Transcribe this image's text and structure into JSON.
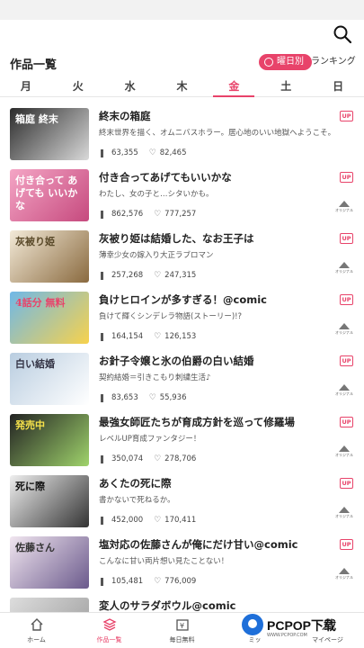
{
  "header": {
    "title": "作品一覧",
    "toggle_day": "曜日別",
    "toggle_rank": "ランキング"
  },
  "days": [
    "月",
    "火",
    "水",
    "木",
    "金",
    "土",
    "日"
  ],
  "active_day": "金",
  "items": [
    {
      "title": "終末の箱庭",
      "sub": "終末世界を描く、オムニバスホラー。居心地のいい地獄へようこそ。",
      "views": "63,355",
      "likes": "82,465",
      "up": "UP",
      "original": "",
      "thumb_text": "箱庭 終末"
    },
    {
      "title": "付き合ってあげてもいいかな",
      "sub": "わたし、女の子と…シタいかも。",
      "views": "862,576",
      "likes": "777,257",
      "up": "UP",
      "original": "オリジナル",
      "thumb_text": "付き合って あげても いいかな"
    },
    {
      "title": "灰被り姫は結婚した、なお王子は",
      "sub": "薄幸少女の嫁入り大正ラブロマン",
      "views": "257,268",
      "likes": "247,315",
      "up": "UP",
      "original": "オリジナル",
      "thumb_text": "灰被り姫"
    },
    {
      "title": "負けヒロインが多すぎる！@comic",
      "sub": "負けて輝くシンデレラ物語(ストーリー)!?",
      "views": "164,154",
      "likes": "126,153",
      "up": "UP",
      "original": "オリジナル",
      "thumb_text": "4話分 無料"
    },
    {
      "title": "お針子令嬢と氷の伯爵の白い結婚",
      "sub": "契約結婚＝引きこもり刺繍生活♪",
      "views": "83,653",
      "likes": "55,936",
      "up": "UP",
      "original": "オリジナル",
      "thumb_text": "白い結婚"
    },
    {
      "title": "最強女師匠たちが育成方針を巡って修羅場",
      "sub": "レベルUP育成ファンタジー！",
      "views": "350,074",
      "likes": "278,706",
      "up": "UP",
      "original": "オリジナル",
      "thumb_text": "発売中"
    },
    {
      "title": "あくたの死に際",
      "sub": "書かないで死ねるか。",
      "views": "452,000",
      "likes": "170,411",
      "up": "UP",
      "original": "オリジナル",
      "thumb_text": "死に際"
    },
    {
      "title": "塩対応の佐藤さんが俺にだけ甘い@comic",
      "sub": "こんなに甘い両片想い見たことない！",
      "views": "105,481",
      "likes": "776,009",
      "up": "UP",
      "original": "オリジナル",
      "thumb_text": "佐藤さん"
    },
    {
      "title": "変人のサラダボウル@comic",
      "sub": "",
      "views": "",
      "likes": "",
      "up": "",
      "original": "",
      "thumb_text": ""
    }
  ],
  "tabbar": [
    {
      "label": "ホーム",
      "icon": "home-icon"
    },
    {
      "label": "作品一覧",
      "icon": "books-icon"
    },
    {
      "label": "毎日無料",
      "icon": "yen-icon"
    },
    {
      "label": "ミッ",
      "icon": "mission-icon"
    },
    {
      "label": "マイページ",
      "icon": "user-icon"
    }
  ],
  "watermark": {
    "text": "PCPOP下载",
    "sub": "WWW.PCPOP.COM"
  },
  "colors": {
    "accent": "#e8436a"
  }
}
